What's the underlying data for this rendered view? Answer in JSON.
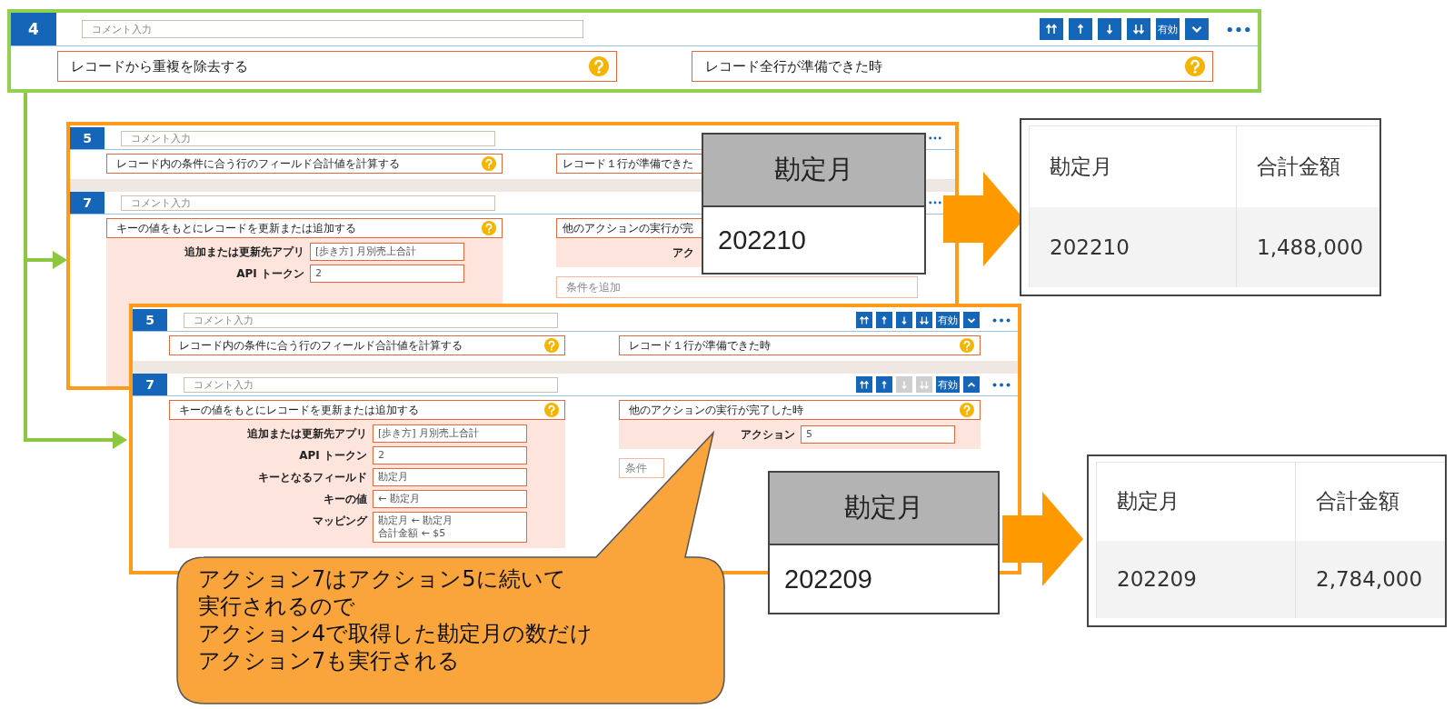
{
  "top_panel": {
    "actions": [
      {
        "number": "4",
        "comment_placeholder": "コメント入力",
        "buttons": [
          {
            "kind": "move-top",
            "disabled": false
          },
          {
            "kind": "move-up",
            "disabled": false
          },
          {
            "kind": "move-down",
            "disabled": false
          },
          {
            "kind": "move-bottom",
            "disabled": false
          }
        ],
        "toggle": "有効",
        "expanded": false,
        "action": "レコードから重複を除去する",
        "action_help": true,
        "trigger": "レコード全行が準備できた時",
        "trigger_help": true
      }
    ]
  },
  "back_panel": {
    "actions": [
      {
        "number": "5",
        "comment_placeholder": "コメント入力",
        "action": "レコード内の条件に合う行のフィールド合計値を計算する",
        "action_help": true,
        "trigger": "レコード１行が準備できた"
      },
      {
        "number": "7",
        "comment_placeholder": "コメント入力",
        "action": "キーの値をもとにレコードを更新または追加する",
        "action_help": true,
        "fields": [
          {
            "label": "追加または更新先アプリ",
            "value": "[歩き方] 月別売上合計"
          },
          {
            "label": "API トークン",
            "value": "2"
          }
        ],
        "trigger": "他のアクションの実行が完",
        "trigger_fields": [
          {
            "label": "アク"
          }
        ],
        "condition_placeholder": "条件を追加"
      }
    ]
  },
  "front_panel": {
    "actions": [
      {
        "number": "5",
        "comment_placeholder": "コメント入力",
        "buttons": [
          {
            "kind": "move-top",
            "disabled": false
          },
          {
            "kind": "move-up",
            "disabled": false
          },
          {
            "kind": "move-down",
            "disabled": false
          },
          {
            "kind": "move-bottom",
            "disabled": false
          }
        ],
        "toggle": "有効",
        "expanded": false,
        "action": "レコード内の条件に合う行のフィールド合計値を計算する",
        "action_help": true,
        "trigger": "レコード１行が準備できた時",
        "trigger_help": true
      },
      {
        "number": "7",
        "comment_placeholder": "コメント入力",
        "buttons": [
          {
            "kind": "move-top",
            "disabled": false
          },
          {
            "kind": "move-up",
            "disabled": false
          },
          {
            "kind": "move-down",
            "disabled": true
          },
          {
            "kind": "move-bottom",
            "disabled": true
          }
        ],
        "toggle": "有効",
        "expanded": true,
        "action": "キーの値をもとにレコードを更新または追加する",
        "action_help": true,
        "fields": [
          {
            "label": "追加または更新先アプリ",
            "value": "[歩き方] 月別売上合計"
          },
          {
            "label": "API トークン",
            "value": "2"
          },
          {
            "label": "キーとなるフィールド",
            "value": "勘定月"
          },
          {
            "label": "キーの値",
            "value": "← 勘定月"
          },
          {
            "label": "マッピング",
            "lines": [
              "勘定月 ← 勘定月",
              "合計金額 ← $5"
            ]
          }
        ],
        "trigger": "他のアクションの実行が完了した時",
        "trigger_help": true,
        "trigger_fields": [
          {
            "label": "アクション",
            "value": "5"
          }
        ],
        "condition_placeholder": "条件"
      }
    ]
  },
  "key_boxes": [
    {
      "header": "勘定月",
      "value": "202210"
    },
    {
      "header": "勘定月",
      "value": "202209"
    }
  ],
  "result_tables": [
    {
      "columns": [
        "勘定月",
        "合計金額"
      ],
      "rows": [
        [
          "202210",
          "1,488,000"
        ]
      ]
    },
    {
      "columns": [
        "勘定月",
        "合計金額"
      ],
      "rows": [
        [
          "202209",
          "2,784,000"
        ]
      ]
    }
  ],
  "callout": {
    "lines": [
      "アクション7はアクション5に続いて",
      "実行されるので",
      "アクション4で取得した勘定月の数だけ",
      "アクション7も実行される"
    ]
  }
}
